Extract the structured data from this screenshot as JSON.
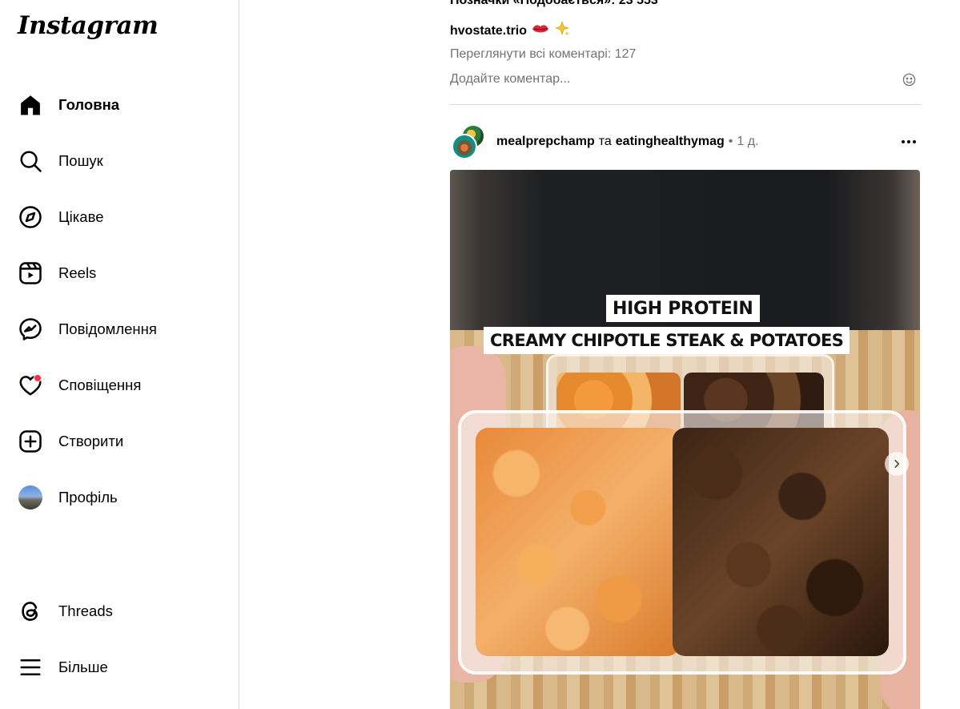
{
  "app": {
    "logo_text": "Instagram"
  },
  "sidebar": {
    "items": [
      {
        "id": "home",
        "label": "Головна",
        "icon": "home-icon",
        "active": true
      },
      {
        "id": "search",
        "label": "Пошук",
        "icon": "search-icon"
      },
      {
        "id": "explore",
        "label": "Цікаве",
        "icon": "compass-icon"
      },
      {
        "id": "reels",
        "label": "Reels",
        "icon": "reels-icon"
      },
      {
        "id": "messages",
        "label": "Повідомлення",
        "icon": "messenger-icon"
      },
      {
        "id": "notifications",
        "label": "Сповіщення",
        "icon": "heart-icon",
        "badge_dot": true
      },
      {
        "id": "create",
        "label": "Створити",
        "icon": "plus-square-icon"
      },
      {
        "id": "profile",
        "label": "Профіль",
        "icon": "avatar"
      }
    ],
    "bottom_items": [
      {
        "id": "threads",
        "label": "Threads",
        "icon": "threads-icon"
      },
      {
        "id": "more",
        "label": "Більше",
        "icon": "menu-icon"
      }
    ],
    "notif_dot_color": "#ff3040"
  },
  "previous_post": {
    "likes_text": "Позначки «Подобається»: 23 553",
    "caption_user": "hvostate.trio",
    "caption_emojis": [
      "lips-emoji",
      "sparkles-emoji"
    ],
    "view_comments_text": "Переглянути всі коментарі: 127",
    "add_comment_placeholder": "Додайте коментар..."
  },
  "post": {
    "user1": "mealprepchamp",
    "conjunction": "та",
    "user2": "eatinghealthymag",
    "separator": "•",
    "time": "1 д.",
    "media": {
      "overlay_line1": "HIGH PROTEIN",
      "overlay_line2": "CREAMY CHIPOTLE STEAK & POTATOES"
    }
  },
  "colors": {
    "secondary_text": "#737373",
    "divider": "#dbdbdb"
  }
}
